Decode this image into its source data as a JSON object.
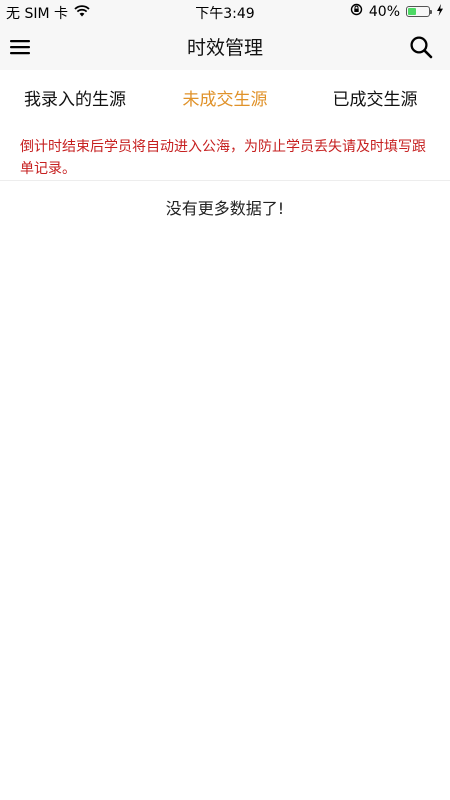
{
  "status_bar": {
    "carrier": "无 SIM 卡",
    "time": "下午3:49",
    "battery_percent": "40%",
    "battery_level": 0.4,
    "icons": [
      "wifi-icon",
      "rotation-lock-icon",
      "battery-icon",
      "charging-bolt-icon"
    ]
  },
  "nav": {
    "title": "时效管理",
    "menu_icon": "menu-icon",
    "search_icon": "search-icon"
  },
  "tabs": [
    {
      "label": "我录入的生源",
      "active": false
    },
    {
      "label": "未成交生源",
      "active": true
    },
    {
      "label": "已成交生源",
      "active": false
    }
  ],
  "notice": {
    "text": "倒计时结束后学员将自动进入公海，为防止学员丢失请及时填写跟单记录。",
    "color": "#c62020"
  },
  "empty": {
    "message": "没有更多数据了!"
  },
  "colors": {
    "accent": "#e0922a",
    "warning_text": "#c62020",
    "bar_background": "#f7f7f7"
  }
}
